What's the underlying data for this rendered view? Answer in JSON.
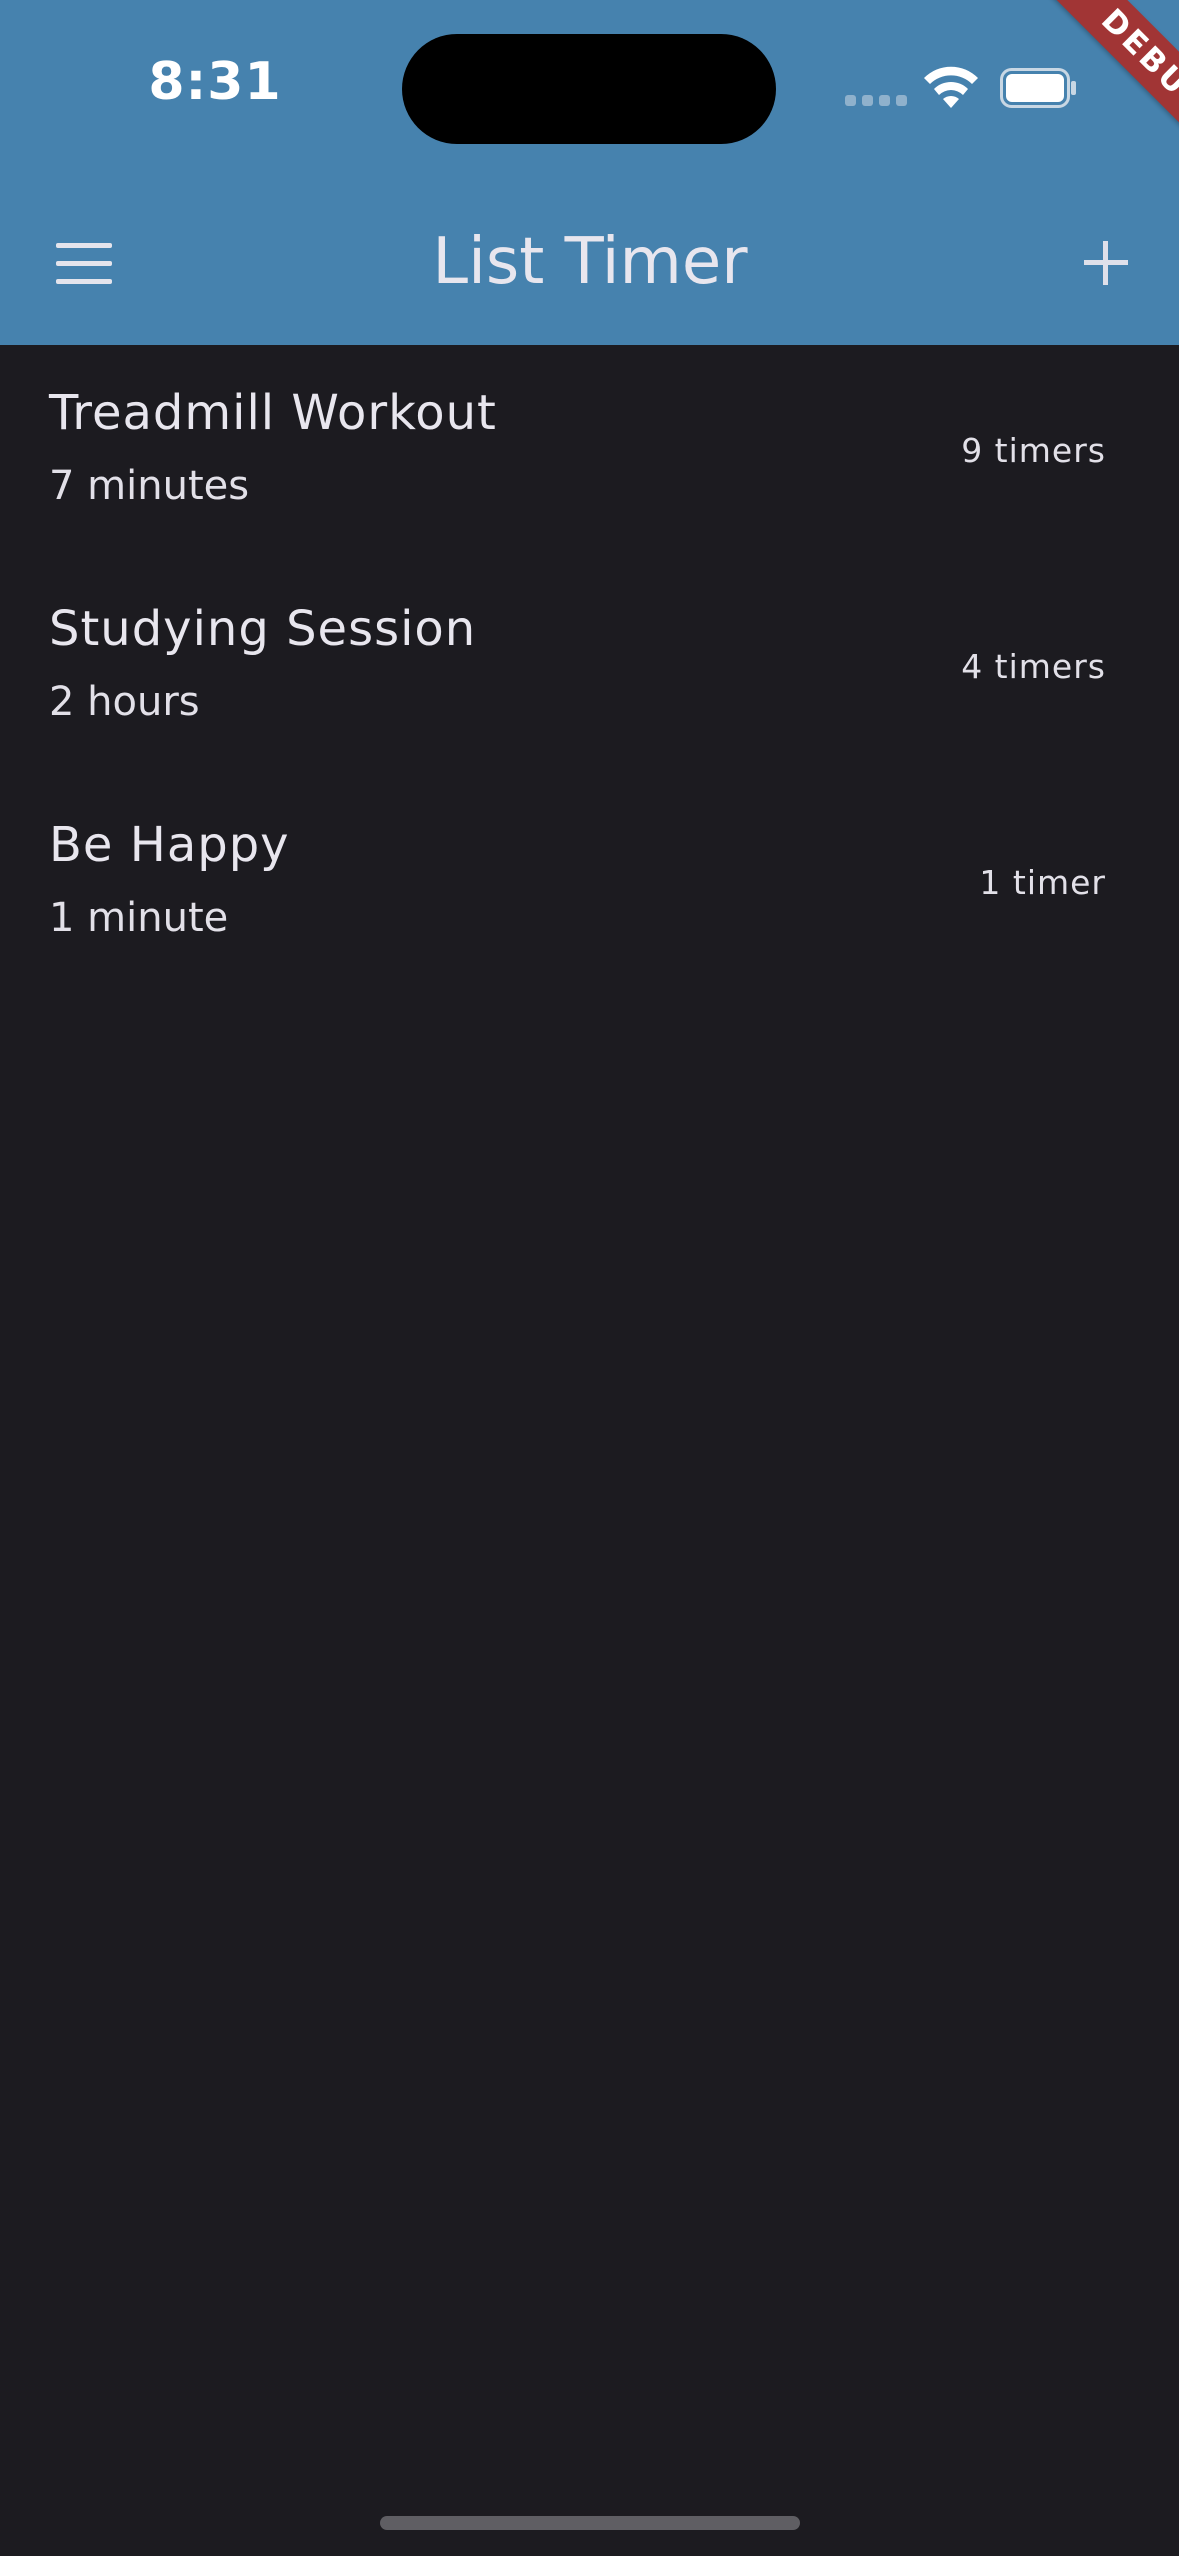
{
  "status_bar": {
    "time": "8:31",
    "icons": [
      "cellular-signal-icon",
      "wifi-icon",
      "battery-icon"
    ]
  },
  "debug_banner": {
    "label": "DEBUG",
    "color": "#a13535"
  },
  "app_bar": {
    "title": "List Timer",
    "menu_icon": "hamburger-menu-icon",
    "add_icon": "plus-icon",
    "background_color": "#4682ae"
  },
  "timer_lists": [
    {
      "title": "Treadmill Workout",
      "duration": "7 minutes",
      "count": "9 timers"
    },
    {
      "title": "Studying Session",
      "duration": "2 hours",
      "count": "4 timers"
    },
    {
      "title": "Be Happy",
      "duration": "1 minute",
      "count": "1 timer"
    }
  ],
  "theme": {
    "background": "#1c1b20",
    "text": "#e8e6ee"
  }
}
